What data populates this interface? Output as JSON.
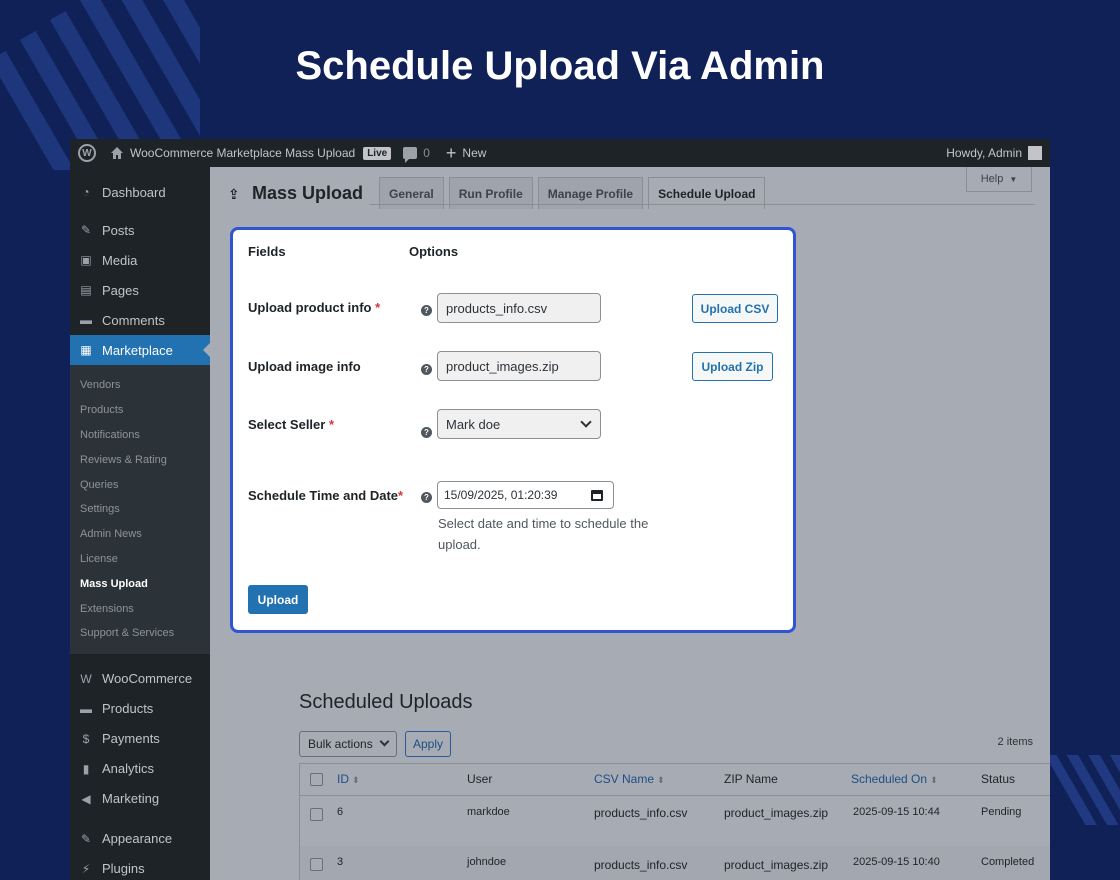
{
  "hero_title": "Schedule Upload Via Admin",
  "adminbar": {
    "site_name": "WooCommerce Marketplace Mass Upload",
    "live_badge": "Live",
    "comments_count": "0",
    "new_label": "New",
    "howdy": "Howdy, Admin"
  },
  "sidebar": {
    "top_items": [
      {
        "label": "Dashboard",
        "icon": "dashboard-icon"
      },
      {
        "label": "Posts",
        "icon": "pin-icon"
      },
      {
        "label": "Media",
        "icon": "media-icon"
      },
      {
        "label": "Pages",
        "icon": "pages-icon"
      },
      {
        "label": "Comments",
        "icon": "comment-icon"
      },
      {
        "label": "Marketplace",
        "icon": "store-icon"
      }
    ],
    "submenu": [
      "Vendors",
      "Products",
      "Notifications",
      "Reviews & Rating",
      "Queries",
      "Settings",
      "Admin News",
      "License",
      "Mass Upload",
      "Extensions",
      "Support & Services"
    ],
    "bottom_items": [
      {
        "label": "WooCommerce",
        "icon": "woocommerce-icon"
      },
      {
        "label": "Products",
        "icon": "archive-icon"
      },
      {
        "label": "Payments",
        "icon": "dollar-icon"
      },
      {
        "label": "Analytics",
        "icon": "bar-chart-icon"
      },
      {
        "label": "Marketing",
        "icon": "megaphone-icon"
      },
      {
        "label": "Appearance",
        "icon": "brush-icon"
      },
      {
        "label": "Plugins",
        "icon": "plugin-icon"
      }
    ]
  },
  "page": {
    "title": "Mass Upload",
    "tabs": [
      "General",
      "Run Profile",
      "Manage Profile",
      "Schedule Upload"
    ],
    "help": "Help"
  },
  "form": {
    "fields_header": "Fields",
    "options_header": "Options",
    "product_info_label": "Upload product info",
    "product_info_value": "products_info.csv",
    "upload_csv": "Upload CSV",
    "image_info_label": "Upload image info",
    "image_info_value": "product_images.zip",
    "upload_zip": "Upload Zip",
    "seller_label": "Select Seller",
    "seller_value": "Mark doe",
    "schedule_label": "Schedule Time and Date",
    "schedule_value": "15/09/2025, 01:20:39",
    "schedule_desc_1": "Select date and time to schedule the",
    "schedule_desc_2": "upload.",
    "required_mark": "*",
    "upload_button": "Upload"
  },
  "scheduled": {
    "title": "Scheduled Uploads",
    "bulk_actions": "Bulk actions",
    "apply": "Apply",
    "items_count": "2 items",
    "columns": [
      "ID",
      "User",
      "CSV Name",
      "ZIP Name",
      "Scheduled On",
      "Status"
    ],
    "rows": [
      {
        "id": "6",
        "user": "markdoe",
        "csv": "products_info.csv",
        "zip": "product_images.zip",
        "scheduled_on": "2025-09-15 10:44",
        "status": "Pending"
      },
      {
        "id": "3",
        "user": "johndoe",
        "csv": "products_info.csv",
        "zip": "product_images.zip",
        "scheduled_on": "2025-09-15 10:40",
        "status": "Completed"
      }
    ]
  }
}
